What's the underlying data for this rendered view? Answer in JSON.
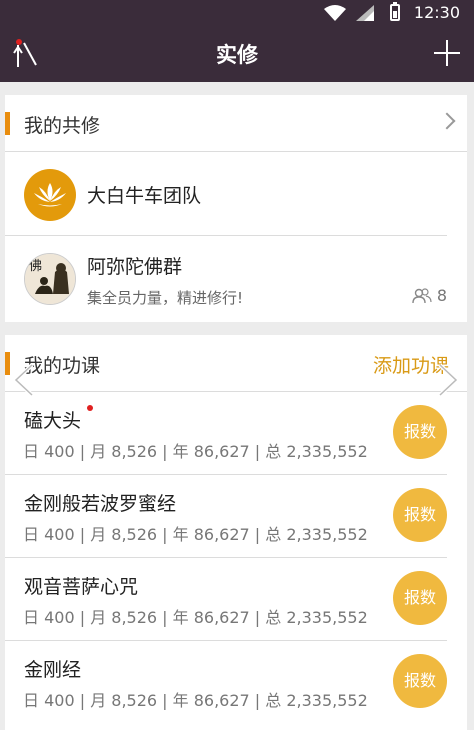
{
  "status_bar": {
    "time": "12:30"
  },
  "header": {
    "title": "实修"
  },
  "shared_practice": {
    "title": "我的共修",
    "groups": [
      {
        "name": "大白牛车团队",
        "desc": "",
        "members": ""
      },
      {
        "name": "阿弥陀佛群",
        "desc": "集全员力量，精进修行!",
        "members": "8"
      }
    ]
  },
  "courses": {
    "title": "我的功课",
    "add_label": "添加功课",
    "report_label": "报数",
    "items": [
      {
        "name": "磕大头",
        "stats": "日 400 | 月 8,526 | 年 86,627 | 总 2,335,552",
        "unread": true
      },
      {
        "name": "金刚般若波罗蜜经",
        "stats": "日 400 | 月 8,526 | 年 86,627 | 总 2,335,552",
        "unread": false
      },
      {
        "name": "观音菩萨心咒",
        "stats": "日 400 | 月 8,526 | 年 86,627 | 总 2,335,552",
        "unread": false
      },
      {
        "name": "金刚经",
        "stats": "日 400 | 月 8,526 | 年 86,627 | 总 2,335,552",
        "unread": false
      }
    ]
  },
  "avatar_text": "佛",
  "colors": {
    "header_bg": "#3a2c3a",
    "accent": "#e98d0e",
    "report_button": "#f0b93f",
    "link": "#d99a16"
  },
  "icons": [
    "wifi-icon",
    "signal-icon",
    "battery-icon",
    "menu-icon",
    "add-icon",
    "chevron-right-icon",
    "lotus-icon",
    "members-icon",
    "arrow-left-icon",
    "arrow-right-icon"
  ]
}
